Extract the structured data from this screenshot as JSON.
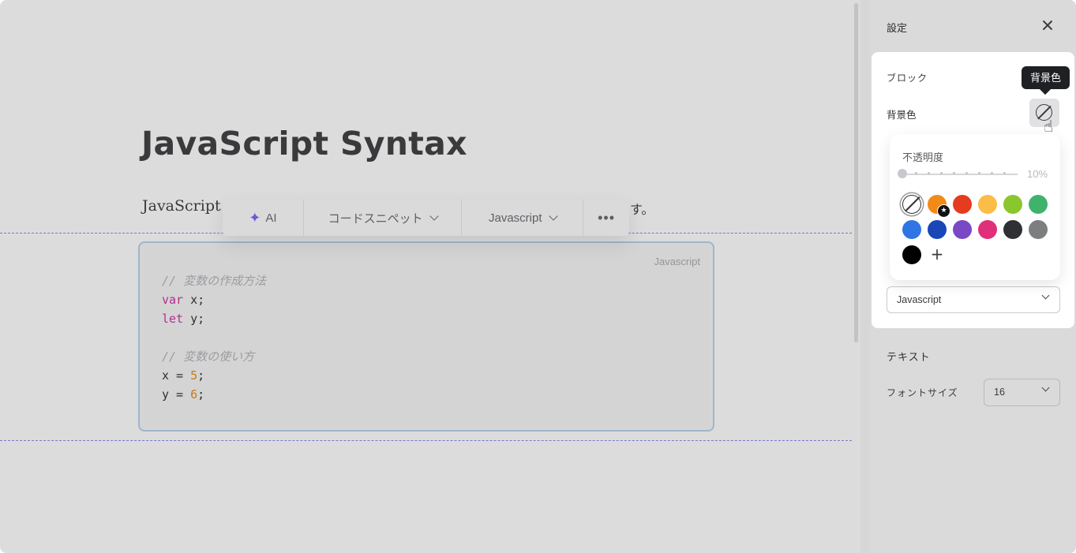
{
  "editor": {
    "title": "JavaScript Syntax",
    "paragraph_start": "JavaScript s",
    "paragraph_tail": "す。",
    "code_block": {
      "language_label": "Javascript",
      "lines": [
        {
          "segments": [
            {
              "text": "// 変数の作成方法",
              "type": "comment"
            }
          ]
        },
        {
          "segments": [
            {
              "text": "var",
              "type": "keyword"
            },
            {
              "text": " x;",
              "type": "plain"
            }
          ]
        },
        {
          "segments": [
            {
              "text": "let",
              "type": "keyword"
            },
            {
              "text": " y;",
              "type": "plain"
            }
          ]
        },
        {
          "segments": []
        },
        {
          "segments": [
            {
              "text": "// 変数の使い方",
              "type": "comment"
            }
          ]
        },
        {
          "segments": [
            {
              "text": "x = ",
              "type": "plain"
            },
            {
              "text": "5",
              "type": "number"
            },
            {
              "text": ";",
              "type": "plain"
            }
          ]
        },
        {
          "segments": [
            {
              "text": "y = ",
              "type": "plain"
            },
            {
              "text": "6",
              "type": "number"
            },
            {
              "text": ";",
              "type": "plain"
            }
          ]
        }
      ]
    }
  },
  "toolbar": {
    "ai_icon": "sparkle-icon",
    "ai_label": "AI",
    "snippet_label": "コードスニペット",
    "language_label": "Javascript",
    "more_label": "•••"
  },
  "settings": {
    "title": "設定",
    "close_icon": "close-icon",
    "block_section": "ブロック",
    "background_label": "背景色",
    "background_tooltip": "背景色",
    "language_select_value": "Javascript",
    "text_section": "テキスト",
    "font_size_label": "フォントサイズ",
    "font_size_value": "16"
  },
  "color_picker": {
    "opacity_label": "不透明度",
    "opacity_value": "10%",
    "opacity_fraction": 0.0,
    "swatches": [
      {
        "name": "none",
        "color": "none",
        "selected": true
      },
      {
        "name": "orange",
        "color": "#f28a17",
        "badge": "star-icon"
      },
      {
        "name": "red",
        "color": "#e53b1f"
      },
      {
        "name": "yellow",
        "color": "#fbbd45"
      },
      {
        "name": "lime",
        "color": "#8ac62d"
      },
      {
        "name": "green",
        "color": "#3fb36c"
      },
      {
        "name": "blue",
        "color": "#2f75e3"
      },
      {
        "name": "navy",
        "color": "#1a46b8"
      },
      {
        "name": "purple",
        "color": "#7a48c6"
      },
      {
        "name": "pink",
        "color": "#e0307a"
      },
      {
        "name": "charcoal",
        "color": "#2e3033"
      },
      {
        "name": "gray",
        "color": "#7d7e80"
      },
      {
        "name": "black",
        "color": "#000000"
      }
    ],
    "add_label": "+"
  }
}
